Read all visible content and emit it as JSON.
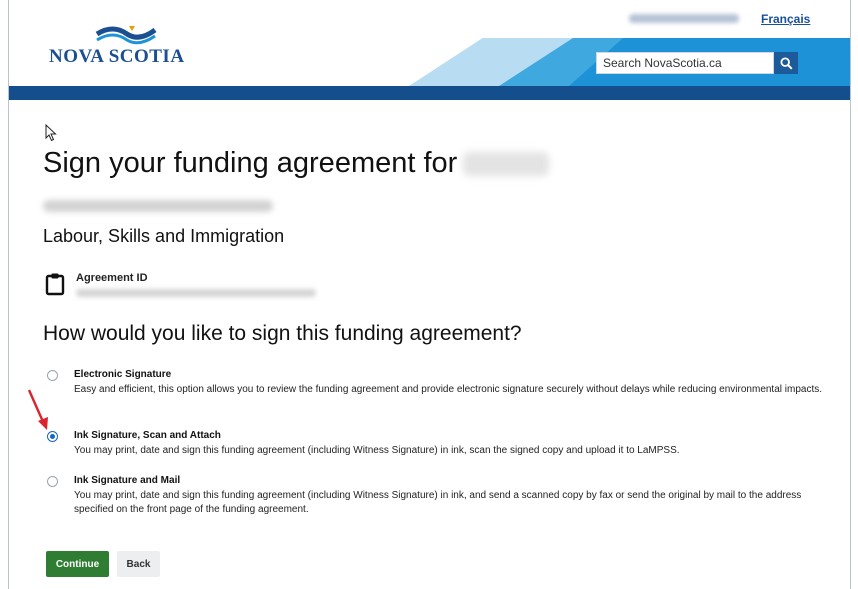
{
  "header": {
    "logo_text": "NOVA SCOTIA",
    "language_link": "Français",
    "search_placeholder": "Search NovaScotia.ca",
    "search_icon": "search-icon",
    "colors": {
      "nav": "#144e8c",
      "band_dark": "#1d92d6",
      "band_mid": "#3ea8df",
      "band_light": "#b8ddf2"
    }
  },
  "page": {
    "title": "Sign your funding agreement for",
    "department": "Labour, Skills and Immigration",
    "agreement_id_label": "Agreement ID",
    "agreement_icon": "clipboard-icon",
    "question": "How would you like to sign this funding agreement?"
  },
  "options": [
    {
      "title": "Electronic Signature",
      "description": "Easy and efficient, this option allows you to review the funding agreement and provide electronic signature securely without delays while reducing environmental impacts.",
      "selected": false
    },
    {
      "title": "Ink Signature, Scan and Attach",
      "description": "You may print, date and sign this funding agreement (including Witness Signature) in ink, scan the signed copy and upload it to LaMPSS.",
      "selected": true
    },
    {
      "title": "Ink Signature and Mail",
      "description": "You may print, date and sign this funding agreement (including Witness Signature) in ink, and send a scanned copy by fax or send the original by mail to the address specified on the front page of the funding agreement.",
      "selected": false
    }
  ],
  "buttons": {
    "continue": "Continue",
    "back": "Back",
    "continue_color": "#2f7d32"
  },
  "annotation": {
    "arrow_color": "#d9232d"
  }
}
